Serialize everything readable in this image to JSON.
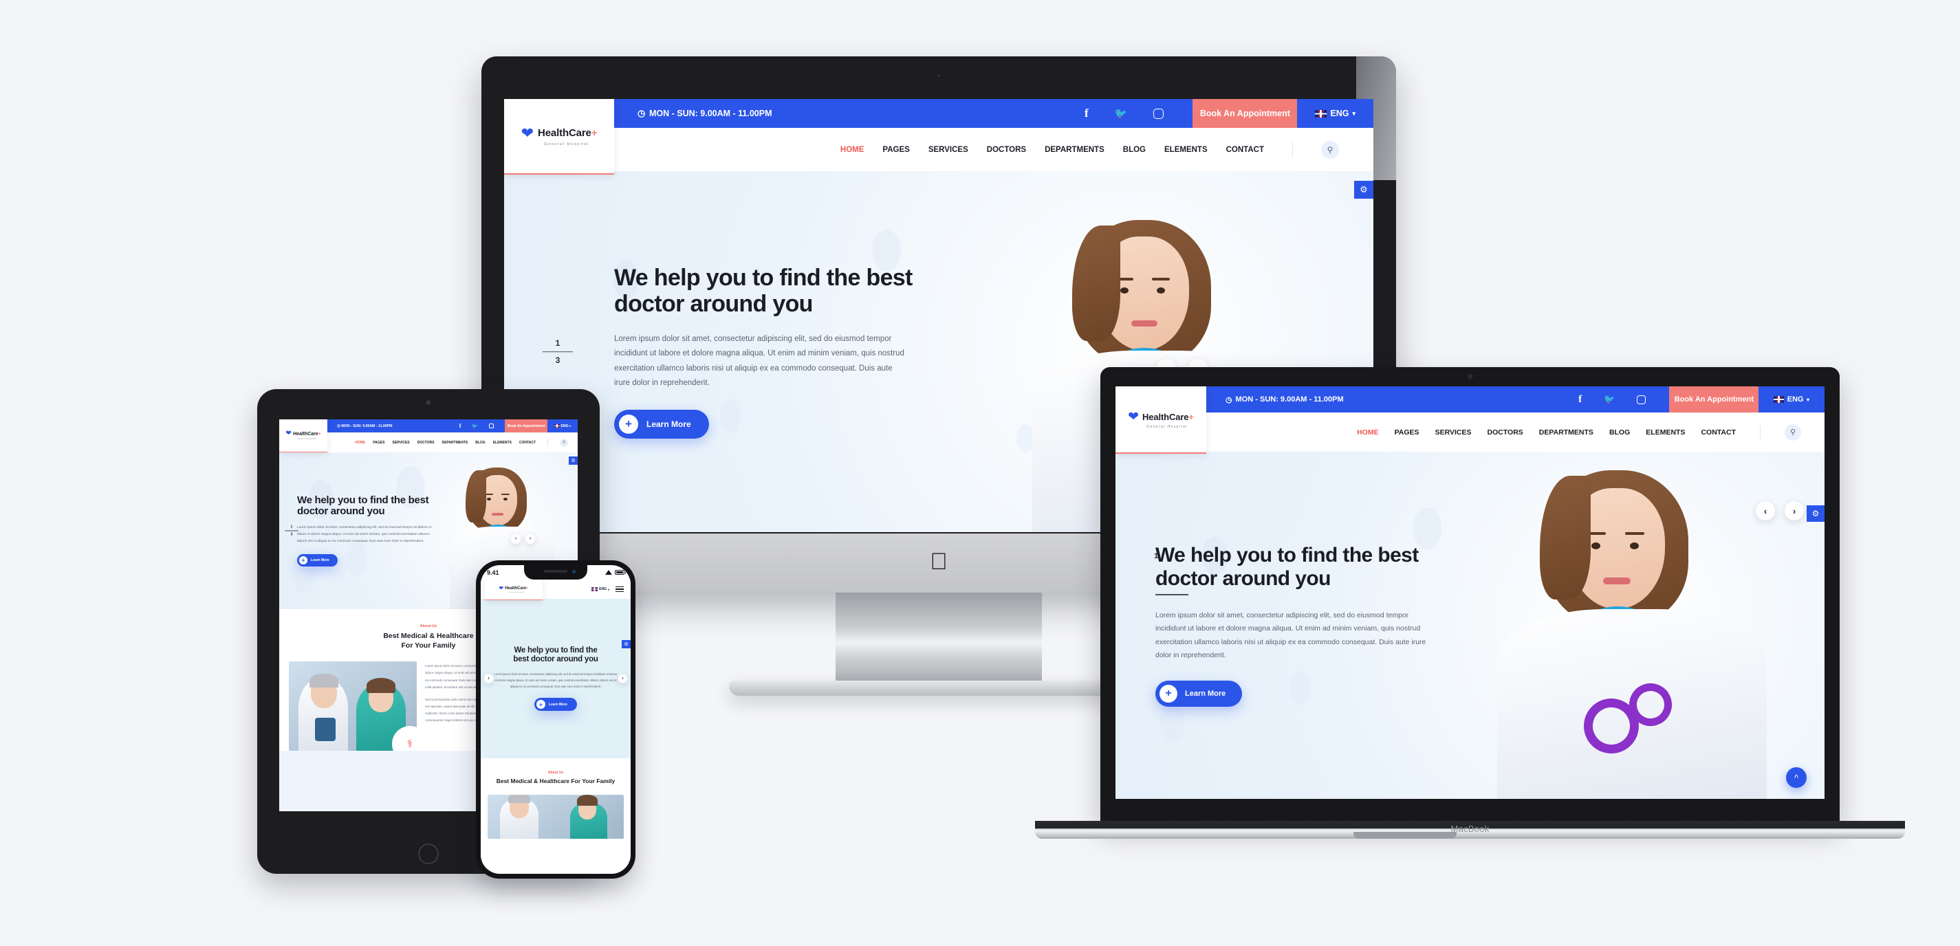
{
  "page": {
    "background_color": "#f4f5f7",
    "title": "HealthCare+ General Hospital responsive website mockup"
  },
  "brand": {
    "name": "HealthCare",
    "plus": "+",
    "tagline": "General Hospital",
    "logo_icon": "heart-pulse-icon",
    "accent_blue": "#2b55e8",
    "accent_red": "#f05a54",
    "book_button_bg": "#f27c77"
  },
  "topbar": {
    "clock_icon": "clock-icon",
    "hours": "MON - SUN: 9.00AM - 11.00PM",
    "social": [
      {
        "name": "facebook-icon",
        "glyph": "f"
      },
      {
        "name": "twitter-icon",
        "glyph": "t"
      },
      {
        "name": "instagram-icon",
        "glyph": "o"
      }
    ],
    "book_label": "Book An Appointment",
    "language": "ENG",
    "language_flag": "uk-flag-icon",
    "caret": "▾"
  },
  "nav": {
    "items": [
      {
        "label": "HOME",
        "active": true
      },
      {
        "label": "PAGES",
        "active": false
      },
      {
        "label": "SERVICES",
        "active": false
      },
      {
        "label": "DOCTORS",
        "active": false
      },
      {
        "label": "DEPARTMENTS",
        "active": false
      },
      {
        "label": "BLOG",
        "active": false
      },
      {
        "label": "ELEMENTS",
        "active": false
      },
      {
        "label": "CONTACT",
        "active": false
      }
    ],
    "search_icon": "search-icon",
    "menu_icon": "hamburger-menu-icon"
  },
  "hero": {
    "heading_line1": "We help you to find the best",
    "heading_line2": "doctor around you",
    "heading_mobile_line1": "We help you to find the",
    "heading_mobile_line2": "best doctor around you",
    "paragraph": "Lorem ipsum dolor sit amet, consectetur adipiscing elit, sed do eiusmod tempor incididunt ut labore et dolore magna aliqua. Ut enim ad minim veniam, quis nostrud exercitation ullamco laboris nisi ut aliquip ex ea commodo consequat. Duis aute irure dolor in reprehenderit.",
    "cta_label": "Learn More",
    "cta_icon": "plus-icon",
    "slide_current": "1",
    "slide_total": "3",
    "prev_icon": "chevron-left-icon",
    "next_icon": "chevron-right-icon",
    "settings_icon": "gear-icon",
    "scroll_top_icon": "chevron-up-icon",
    "doctor_image_alt": "smiling-female-doctor-with-stethoscope"
  },
  "about": {
    "eyebrow": "About Us",
    "heading_line1": "Best Medical & Healthcare",
    "heading_line2": "For Your Family",
    "heading_full": "Best Medical & Healthcare For Your Family",
    "watermark_icon": "nurse-icon",
    "photo_alt": "senior-doctor-and-nurse-reviewing-chart",
    "badge_icon": "caduceus-icon",
    "paragraph_1": "Lorem ipsum dolor sit amet, consectetur adipiscing elit, sed do eiusmod tempor incididunt ut labore et dolore magna aliqua. Ut enim ad minim veniam, quis nostrud exercitation ullamco laboris nisi ut aliquip ex ea commodo consequat. Duis aute irure dolor in reprehenderit in voluptate velit esse cillum dolore eu fugiat nulla pariatur. Excepteur sint occaecat cupidatat non proident, sunt in culpa qui officia deserunt mollit anim.",
    "paragraph_2": "Sed ut perspiciatis unde omnis iste natus error sit voluptatem accusantium doloremque laudantium, totam rem aperiam, eaque ipsa quae ab illo inventore veritatis et quasi architecto beatae vitae dicta sunt explicabo. Nemo enim ipsam voluptatem quia voluptas sit aspernatur aut odit aut fugit, sed quia consequuntur magni dolores eos qui ratione."
  },
  "devices": {
    "imac": {
      "name": "iMac",
      "apple_logo": "apple-logo-icon"
    },
    "macbook": {
      "name": "MacBook",
      "label": "MacBook"
    },
    "ipad": {
      "name": "iPad",
      "home_button": "home-button"
    },
    "iphone": {
      "name": "iPhone",
      "status_time": "9.41",
      "wifi_icon": "wifi-icon",
      "battery_icon": "battery-icon"
    }
  }
}
